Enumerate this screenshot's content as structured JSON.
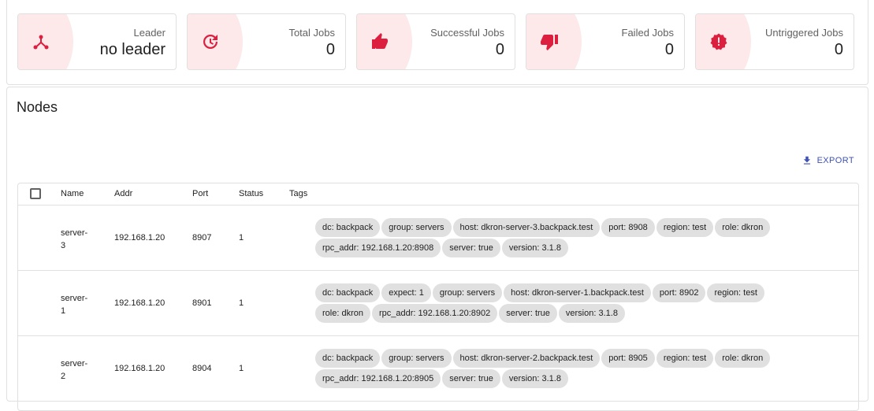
{
  "stats": [
    {
      "label": "Leader",
      "value": "no leader",
      "icon": "leader-icon"
    },
    {
      "label": "Total Jobs",
      "value": "0",
      "icon": "history-icon"
    },
    {
      "label": "Successful Jobs",
      "value": "0",
      "icon": "thumb-up-icon"
    },
    {
      "label": "Failed Jobs",
      "value": "0",
      "icon": "thumb-down-icon"
    },
    {
      "label": "Untriggered Jobs",
      "value": "0",
      "icon": "alert-icon"
    }
  ],
  "accent_color": "#dc1f3f",
  "nodes": {
    "title": "Nodes",
    "export_label": "EXPORT",
    "columns": [
      "Name",
      "Addr",
      "Port",
      "Status",
      "Tags"
    ],
    "rows": [
      {
        "name": "server-3",
        "addr": "192.168.1.20",
        "port": "8907",
        "status": "1",
        "tags": [
          "dc: backpack",
          "group: servers",
          "host: dkron-server-3.backpack.test",
          "port: 8908",
          "region: test",
          "role: dkron",
          "rpc_addr: 192.168.1.20:8908",
          "server: true",
          "version: 3.1.8"
        ]
      },
      {
        "name": "server-1",
        "addr": "192.168.1.20",
        "port": "8901",
        "status": "1",
        "tags": [
          "dc: backpack",
          "expect: 1",
          "group: servers",
          "host: dkron-server-1.backpack.test",
          "port: 8902",
          "region: test",
          "role: dkron",
          "rpc_addr: 192.168.1.20:8902",
          "server: true",
          "version: 3.1.8"
        ]
      },
      {
        "name": "server-2",
        "addr": "192.168.1.20",
        "port": "8904",
        "status": "1",
        "tags": [
          "dc: backpack",
          "group: servers",
          "host: dkron-server-2.backpack.test",
          "port: 8905",
          "region: test",
          "role: dkron",
          "rpc_addr: 192.168.1.20:8905",
          "server: true",
          "version: 3.1.8"
        ]
      }
    ]
  }
}
